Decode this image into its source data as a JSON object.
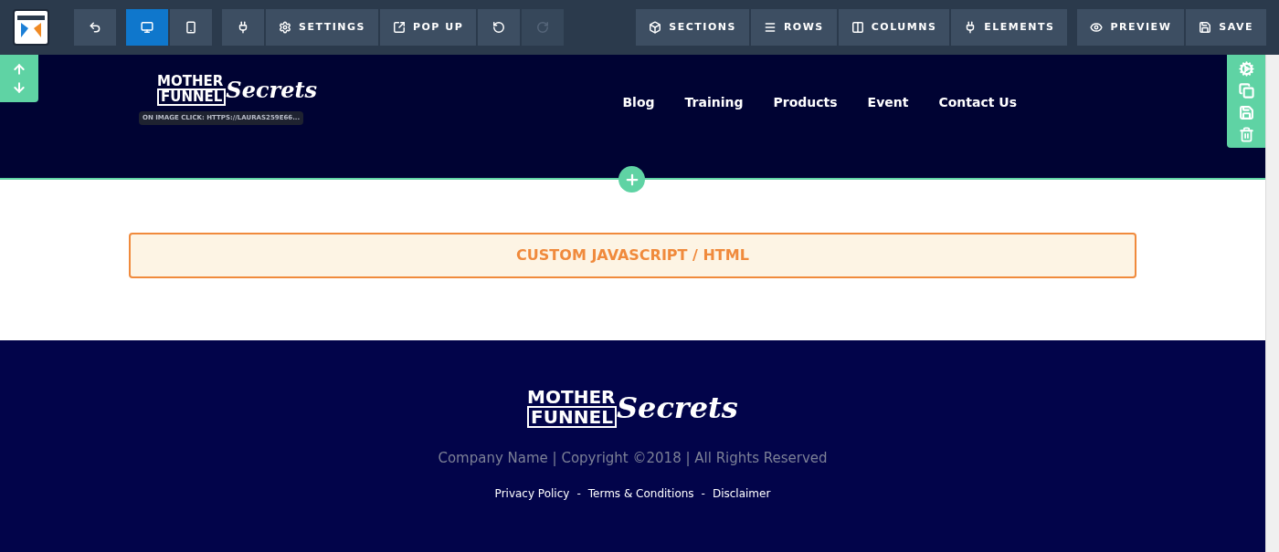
{
  "toolbar": {
    "groups": [
      [
        {
          "kind": "icon",
          "selected": false,
          "disabled": false
        }
      ],
      [
        {
          "kind": "icon",
          "selected": true,
          "disabled": false
        },
        {
          "kind": "icon",
          "selected": false,
          "disabled": false
        }
      ],
      [
        {
          "kind": "icon",
          "selected": false,
          "disabled": false
        },
        {
          "kind": "label",
          "label": "SETTINGS",
          "selected": false,
          "disabled": false
        },
        {
          "kind": "label",
          "label": "POP UP",
          "selected": false,
          "disabled": false
        },
        {
          "kind": "icon",
          "selected": false,
          "disabled": false
        },
        {
          "kind": "icon",
          "selected": false,
          "disabled": true
        }
      ],
      [
        {
          "kind": "label",
          "label": "SECTIONS",
          "selected": false,
          "disabled": false
        },
        {
          "kind": "label",
          "label": "ROWS",
          "selected": false,
          "disabled": false
        },
        {
          "kind": "label",
          "label": "COLUMNS",
          "selected": false,
          "disabled": false
        },
        {
          "kind": "label",
          "label": "ELEMENTS",
          "selected": false,
          "disabled": false
        }
      ],
      [
        {
          "kind": "label",
          "label": "PREVIEW",
          "selected": false,
          "disabled": false
        },
        {
          "kind": "label",
          "label": "SAVE",
          "selected": false,
          "disabled": false
        }
      ]
    ]
  },
  "header": {
    "logo": {
      "line_1": "MOTHER",
      "line_2": "FUNNEL",
      "script": "Secrets"
    },
    "image_tooltip": "ON IMAGE CLICK: HTTPS://LAURAS259E66...",
    "nav": [
      "Blog",
      "Training",
      "Products",
      "Event",
      "Contact Us"
    ]
  },
  "content": {
    "custom_code_block": "CUSTOM JAVASCRIPT / HTML"
  },
  "footer": {
    "logo": {
      "line_1": "MOTHER",
      "line_2": "FUNNEL",
      "script": "Secrets"
    },
    "copyright": "Company Name | Copyright ©2018 | All Rights Reserved",
    "separator": "-",
    "links": [
      "Privacy Policy",
      "Terms & Conditions",
      "Disclaimer"
    ]
  }
}
